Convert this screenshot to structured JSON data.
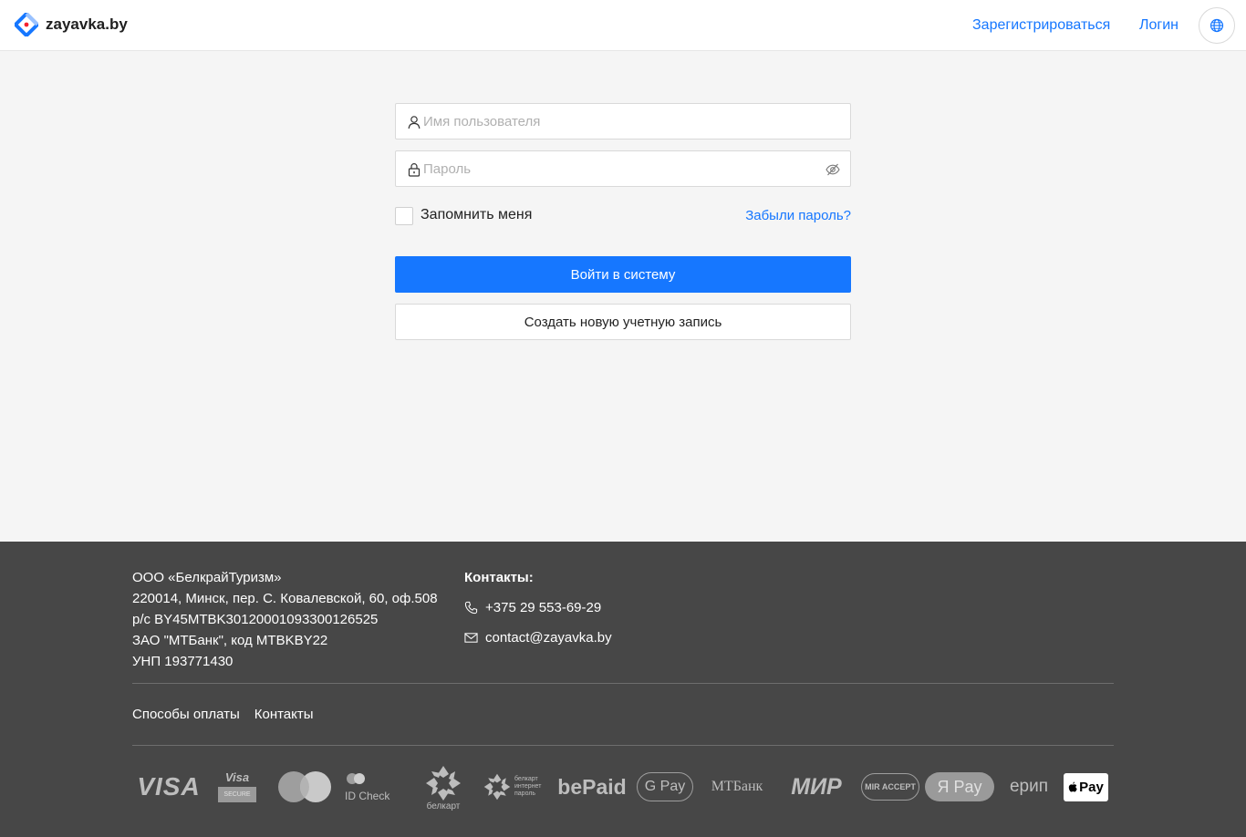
{
  "header": {
    "brand": "zayavka.by",
    "register_link": "Зарегистрироваться",
    "login_link": "Логин",
    "language_icon": "globe-icon"
  },
  "login_form": {
    "username_placeholder": "Имя пользователя",
    "password_placeholder": "Пароль",
    "remember_label": "Запомнить меня",
    "forgot_link": "Забыли пароль?",
    "submit_button": "Войти в систему",
    "create_account_button": "Создать новую учетную запись"
  },
  "footer": {
    "company_lines": [
      "ООО «БелкрайТуризм»",
      "220014, Минск, пер. С. Ковалевской, 60, оф.508",
      "р/с BY45MTBK30120001093300126525",
      "ЗАО \"МТБанк\", код MTBKBY22",
      "УНП 193771430"
    ],
    "contacts_title": "Контакты:",
    "phone": "+375 29 553-69-29",
    "email": "contact@zayavka.by",
    "links": [
      "Способы оплаты",
      "Контакты"
    ],
    "payment_logos": [
      {
        "text": "VISA"
      },
      {
        "text": "Visa",
        "subtext": "SECURE"
      },
      {
        "text": "mastercard"
      },
      {
        "text": "ID Check"
      },
      {
        "text": "белкарт"
      },
      {
        "text": "белкарт интернет пароль"
      },
      {
        "text": "bePaid"
      },
      {
        "text": "G Pay"
      },
      {
        "text": "МТБанк"
      },
      {
        "text": "МИР"
      },
      {
        "text": "MIR ACCEPT"
      },
      {
        "text": "Я Pay"
      },
      {
        "text": "ерип"
      },
      {
        "text": "Pay"
      }
    ]
  },
  "colors": {
    "accent": "#1677ff",
    "footer_bg": "#474747",
    "page_bg": "#f5f5f5"
  }
}
